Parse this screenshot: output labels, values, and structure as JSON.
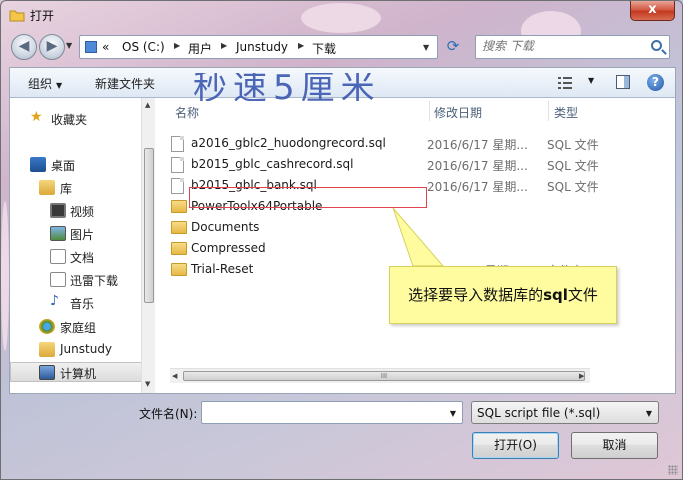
{
  "window": {
    "title": "打开",
    "close_glyph": "x"
  },
  "address": {
    "prefix": "«",
    "segments": [
      "OS (C:)",
      "用户",
      "Junstudy",
      "下载"
    ]
  },
  "search": {
    "placeholder": "搜索 下载"
  },
  "toolbar": {
    "organize_label": "组织",
    "new_folder_label": "新建文件夹",
    "watermark_text": "秒速5厘米"
  },
  "sidebar": {
    "items": [
      {
        "label": "收藏夹",
        "icon": "star-icon"
      },
      {
        "label": "桌面",
        "icon": "desktop-icon"
      },
      {
        "label": "库",
        "icon": "library-icon"
      },
      {
        "label": "视频",
        "icon": "video-icon"
      },
      {
        "label": "图片",
        "icon": "picture-icon"
      },
      {
        "label": "文档",
        "icon": "document-icon"
      },
      {
        "label": "迅雷下载",
        "icon": "thunder-download-icon"
      },
      {
        "label": "音乐",
        "icon": "music-icon"
      },
      {
        "label": "家庭组",
        "icon": "homegroup-icon"
      },
      {
        "label": "Junstudy",
        "icon": "user-folder-icon"
      },
      {
        "label": "计算机",
        "icon": "computer-icon"
      }
    ]
  },
  "columns": {
    "name": "名称",
    "modified": "修改日期",
    "type": "类型"
  },
  "files": [
    {
      "name": "a2016_gblc2_huodongrecord.sql",
      "date": "2016/6/17 星期...",
      "type": "SQL 文件",
      "kind": "file"
    },
    {
      "name": "b2015_gblc_cashrecord.sql",
      "date": "2016/6/17 星期...",
      "type": "SQL 文件",
      "kind": "file"
    },
    {
      "name": "b2015_gblc_bank.sql",
      "date": "2016/6/17 星期...",
      "type": "SQL 文件",
      "kind": "file"
    },
    {
      "name": "PowerToolx64Portable",
      "date": "",
      "type": "",
      "kind": "folder"
    },
    {
      "name": "Documents",
      "date": "",
      "type": "",
      "kind": "folder"
    },
    {
      "name": "Compressed",
      "date": "",
      "type": "",
      "kind": "folder"
    },
    {
      "name": "Trial-Reset",
      "date": "2016/2/2 星期二 ...",
      "type": "文件夹",
      "kind": "folder"
    }
  ],
  "callout": {
    "text_before": "选择要导入数据库的",
    "text_bold": "sql",
    "text_after": "文件"
  },
  "bottom": {
    "filename_label": "文件名(N):",
    "filename_value": "",
    "filter_value": "SQL script file (*.sql)",
    "open_label": "打开(O)",
    "cancel_label": "取消"
  },
  "colors": {
    "highlight_border": "#e0444f",
    "callout_bg": "#fffc9f",
    "close_button": "#c2391f"
  }
}
